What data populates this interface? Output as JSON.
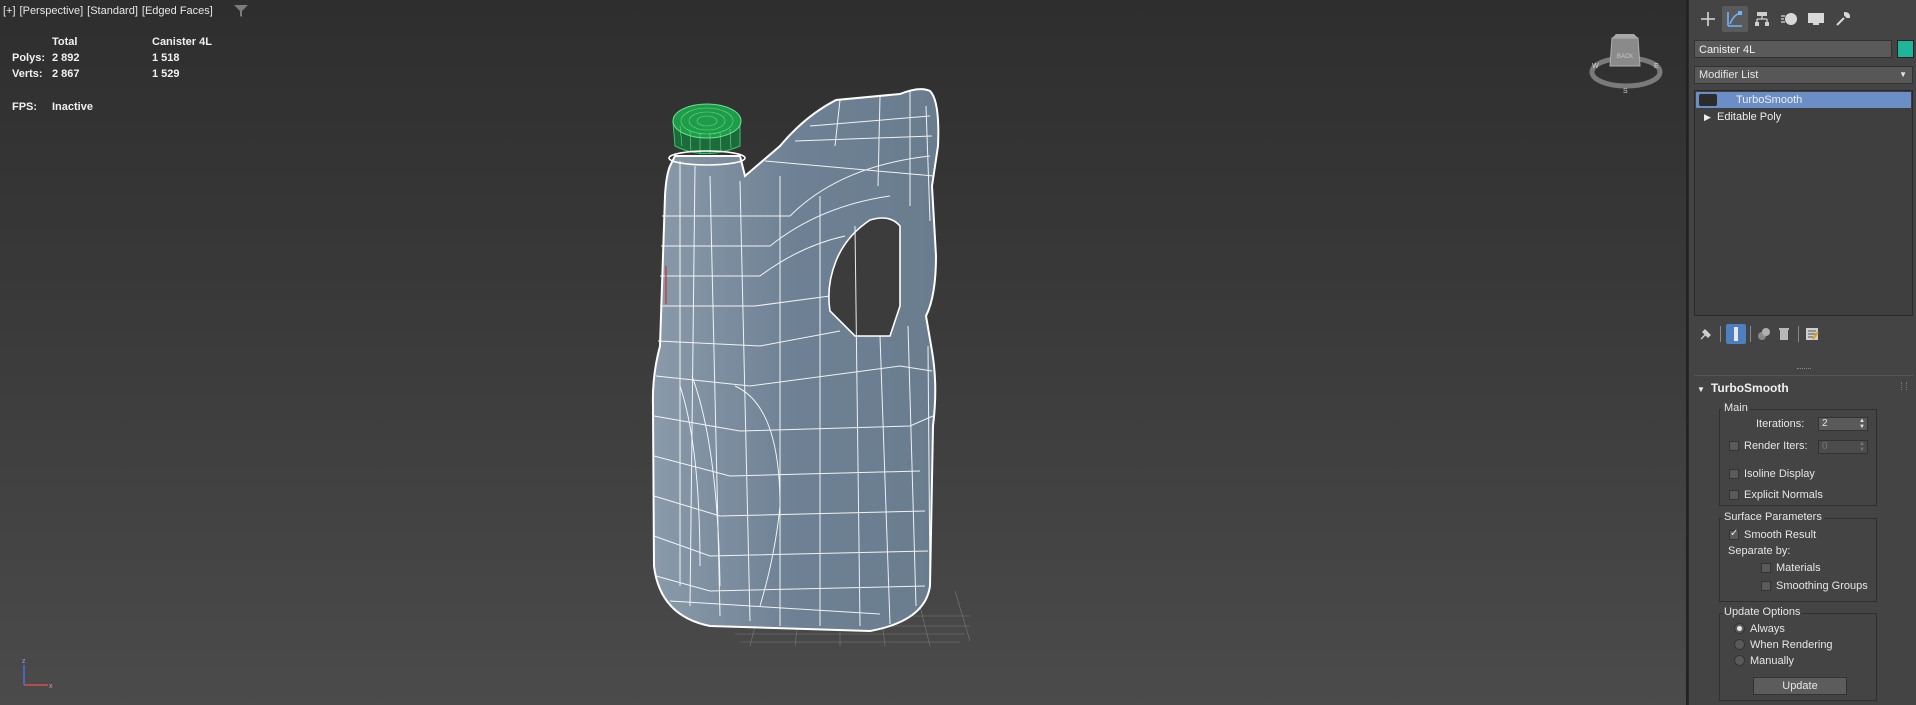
{
  "viewport": {
    "label_parts": [
      "[+]",
      "[Perspective]",
      "[Standard]",
      "[Edged Faces]"
    ],
    "stats": {
      "col_total": "Total",
      "col_object": "Canister 4L",
      "polys_label": "Polys:",
      "polys_total": "2 892",
      "polys_object": "1 518",
      "verts_label": "Verts:",
      "verts_total": "2 867",
      "verts_object": "1 529",
      "fps_label": "FPS:",
      "fps_value": "Inactive"
    },
    "viewcube_label": "BACK"
  },
  "command_panel": {
    "tabs": [
      {
        "name": "create",
        "icon": "plus-icon"
      },
      {
        "name": "modify",
        "icon": "modify-icon"
      },
      {
        "name": "hierarchy",
        "icon": "hierarchy-icon"
      },
      {
        "name": "motion",
        "icon": "motion-icon"
      },
      {
        "name": "display",
        "icon": "display-icon"
      },
      {
        "name": "utilities",
        "icon": "wrench-icon"
      }
    ],
    "object_name": "Canister 4L",
    "object_color": "#1fb59a",
    "modifier_list_label": "Modifier List",
    "stack": [
      {
        "label": "TurboSmooth",
        "selected": true
      },
      {
        "label": "Editable Poly",
        "selected": false
      }
    ]
  },
  "turbosmooth": {
    "title": "TurboSmooth",
    "main": {
      "title": "Main",
      "iterations_label": "Iterations:",
      "iterations_value": "2",
      "render_iters_label": "Render Iters:",
      "render_iters_value": "0",
      "isoline_label": "Isoline Display",
      "explicit_normals_label": "Explicit Normals"
    },
    "surface": {
      "title": "Surface Parameters",
      "smooth_result_label": "Smooth Result",
      "separate_by_label": "Separate by:",
      "materials_label": "Materials",
      "smoothing_groups_label": "Smoothing Groups"
    },
    "update": {
      "title": "Update Options",
      "always_label": "Always",
      "when_rendering_label": "When Rendering",
      "manually_label": "Manually",
      "update_button": "Update"
    }
  },
  "colors": {
    "selection": "#6b8ec7",
    "cap_green": "#1f9c4a",
    "mesh_body": "#6f8294"
  }
}
